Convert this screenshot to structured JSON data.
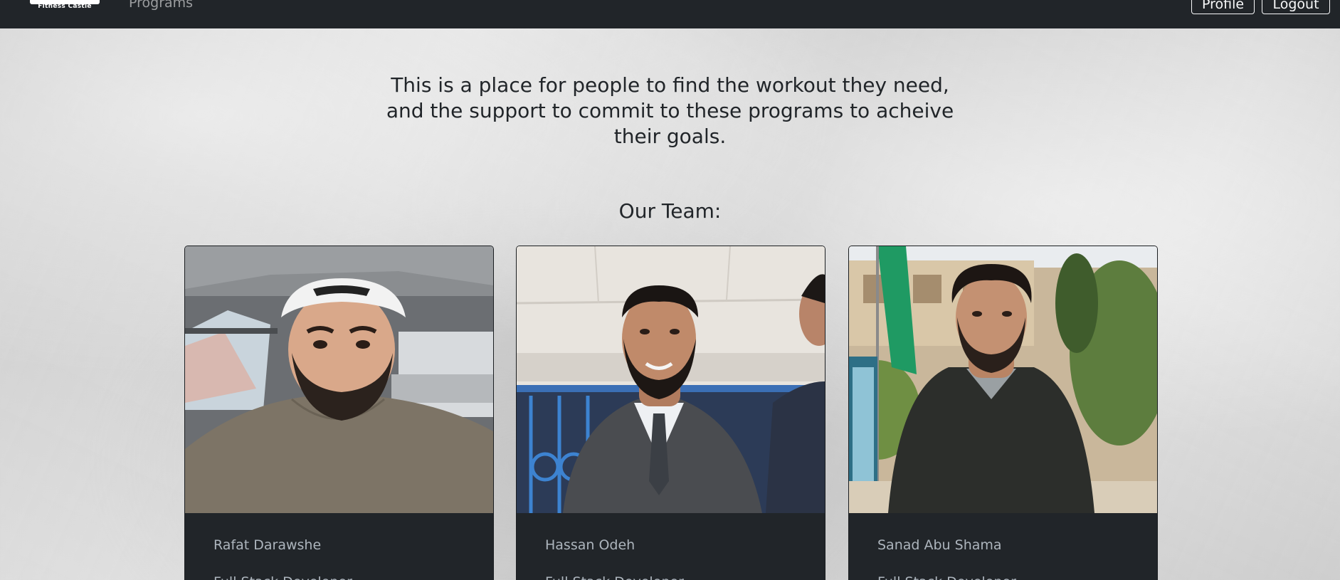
{
  "navbar": {
    "brand_text": "Fitness Castle",
    "links": [
      {
        "label": "Programs"
      }
    ],
    "profile_label": "Profile",
    "logout_label": "Logout"
  },
  "intro": {
    "line1": "This is a place for people to find the workout they need,",
    "line2": "and the support to commit to these programs to acheive",
    "line3": "their goals."
  },
  "team": {
    "heading": "Our Team:",
    "members": [
      {
        "name": "Rafat Darawshe",
        "role": "Full Stack Developer"
      },
      {
        "name": "Hassan Odeh",
        "role": "Full Stack Developer"
      },
      {
        "name": "Sanad Abu Shama",
        "role": "Full Stack Developer"
      }
    ]
  },
  "colors": {
    "navbar_bg": "#212529",
    "card_body_bg": "#212529",
    "muted_text": "#adb5bd",
    "heading_text": "#212529",
    "page_bg": "#dcdcdc"
  }
}
